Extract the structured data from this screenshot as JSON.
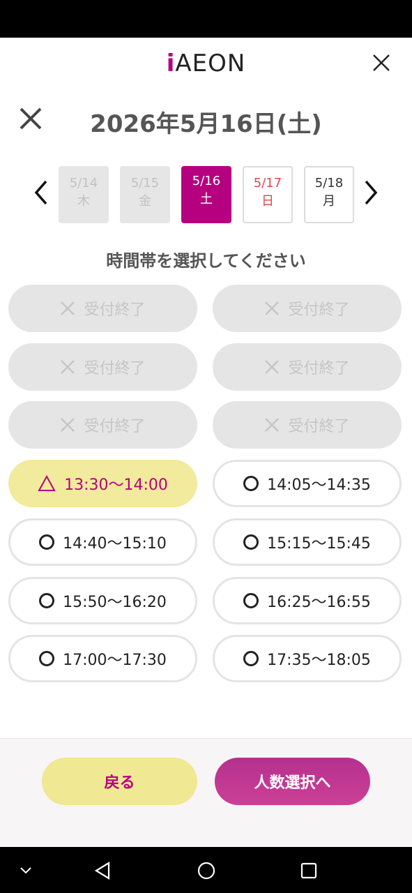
{
  "header": {
    "logo_i": "i",
    "logo_rest": "AEON"
  },
  "date_header": {
    "title": "2026年5月16日(土)"
  },
  "days": [
    {
      "date": "5/14",
      "weekday": "木",
      "state": "disabled"
    },
    {
      "date": "5/15",
      "weekday": "金",
      "state": "disabled"
    },
    {
      "date": "5/16",
      "weekday": "土",
      "state": "selected"
    },
    {
      "date": "5/17",
      "weekday": "日",
      "state": "sunday"
    },
    {
      "date": "5/18",
      "weekday": "月",
      "state": "normal"
    }
  ],
  "section": {
    "heading": "時間帯を選択してください"
  },
  "slots": [
    {
      "label": "受付終了",
      "mark": "×",
      "state": "closed"
    },
    {
      "label": "受付終了",
      "mark": "×",
      "state": "closed"
    },
    {
      "label": "受付終了",
      "mark": "×",
      "state": "closed"
    },
    {
      "label": "受付終了",
      "mark": "×",
      "state": "closed"
    },
    {
      "label": "受付終了",
      "mark": "×",
      "state": "closed"
    },
    {
      "label": "受付終了",
      "mark": "×",
      "state": "closed"
    },
    {
      "label": "13:30〜14:00",
      "mark": "△",
      "state": "selected"
    },
    {
      "label": "14:05〜14:35",
      "mark": "○",
      "state": "open"
    },
    {
      "label": "14:40〜15:10",
      "mark": "○",
      "state": "open"
    },
    {
      "label": "15:15〜15:45",
      "mark": "○",
      "state": "open"
    },
    {
      "label": "15:50〜16:20",
      "mark": "○",
      "state": "open"
    },
    {
      "label": "16:25〜16:55",
      "mark": "○",
      "state": "open"
    },
    {
      "label": "17:00〜17:30",
      "mark": "○",
      "state": "open"
    },
    {
      "label": "17:35〜18:05",
      "mark": "○",
      "state": "open"
    }
  ],
  "footer": {
    "back_label": "戻る",
    "next_label": "人数選択へ"
  },
  "colors": {
    "brand": "#b5007f",
    "selected_slot": "#f2ea9c",
    "sunday": "#e0474c"
  }
}
